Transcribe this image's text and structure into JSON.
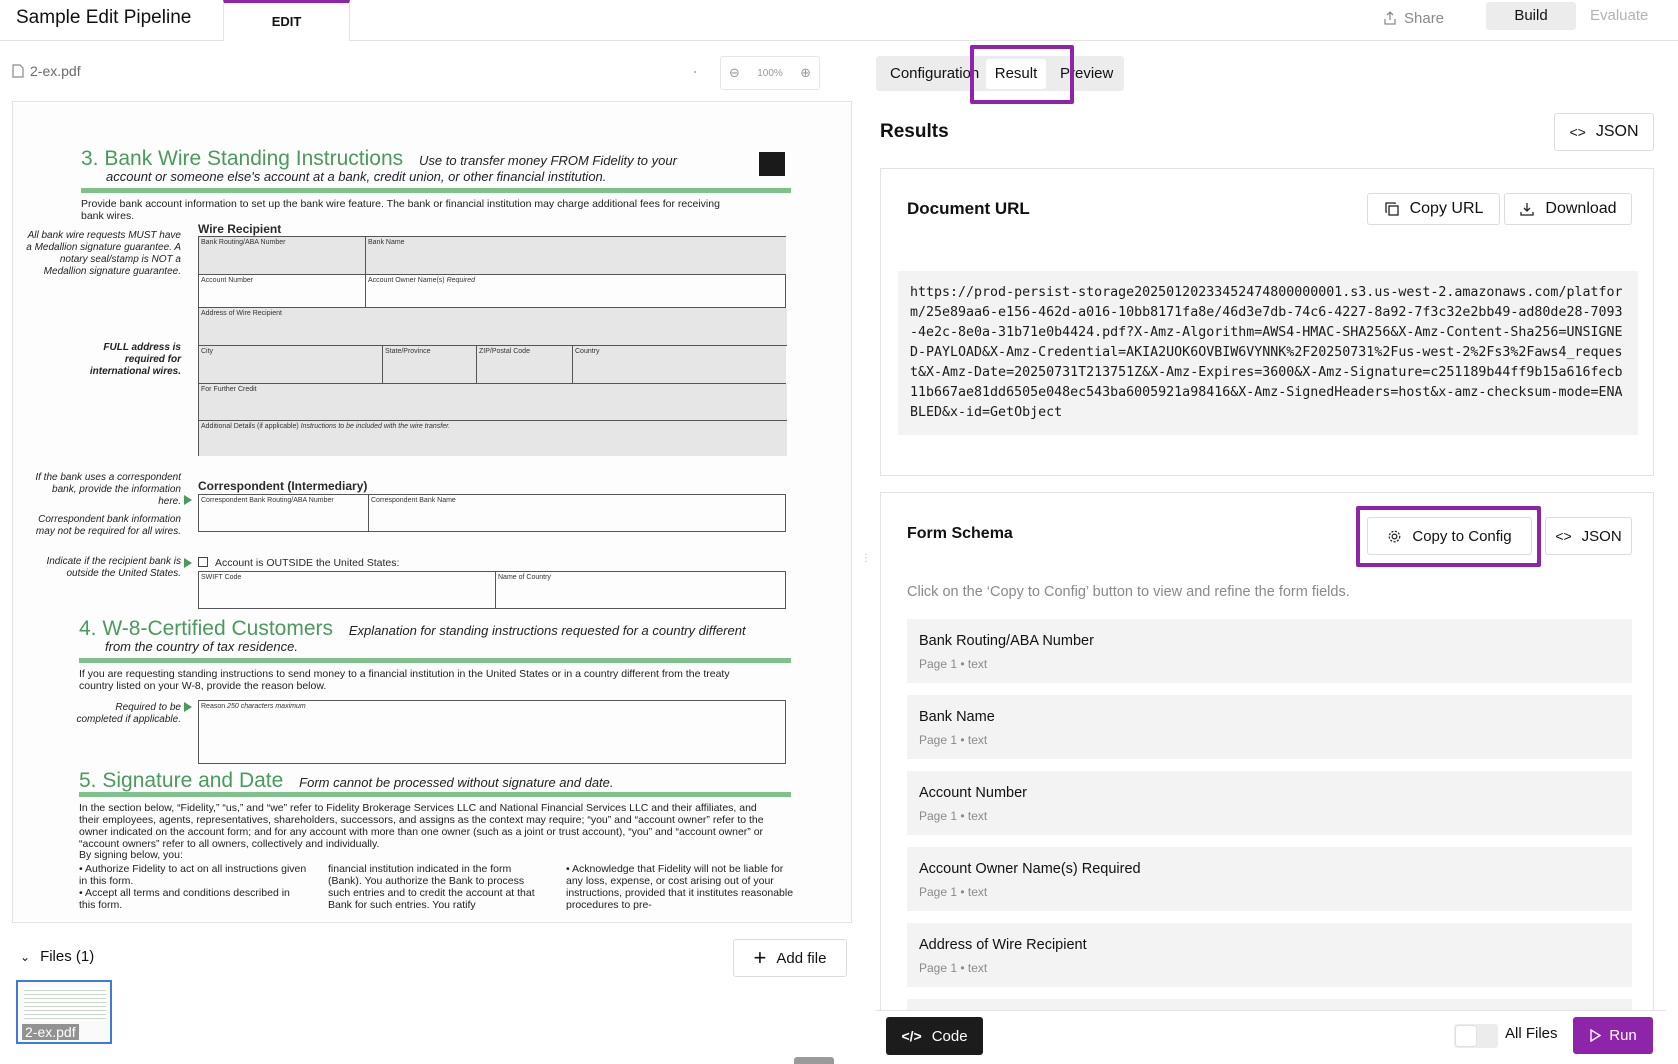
{
  "header": {
    "app_title": "Sample Edit Pipeline",
    "edit_tab": "EDIT",
    "share_label": "Share",
    "build_label": "Build",
    "evaluate_label": "Evaluate"
  },
  "viewer": {
    "file_name": "2-ex.pdf",
    "zoom": "100%"
  },
  "document": {
    "s3_title": "3. Bank Wire Standing Instructions",
    "s3_sub1": "Use to transfer money FROM Fidelity to your",
    "s3_sub2": "account or someone else's account at a bank, credit union, or other financial institution.",
    "s3_intro": "Provide bank account information to set up the bank wire feature. The bank or financial institution may charge additional fees for receiving bank wires.",
    "note_medallion": "All bank wire requests MUST have a Medallion signature guarantee. A notary seal/stamp is NOT a Medallion signature guarantee.",
    "note_address": "FULL address is required for international wires.",
    "wire_recipient": "Wire Recipient",
    "f_routing": "Bank Routing/ABA Number",
    "f_bank_name": "Bank Name",
    "f_account_number": "Account Number",
    "f_owner": "Account Owner Name(s)",
    "f_owner_req": "Required",
    "f_address": "Address of Wire Recipient",
    "f_city": "City",
    "f_state": "State/Province",
    "f_zip": "ZIP/Postal Code",
    "f_country": "Country",
    "f_further": "For Further Credit",
    "f_additional": "Additional Details (if applicable)",
    "f_additional_note": "Instructions to be included with the wire transfer.",
    "note_correspondent": "If the bank uses a correspondent bank, provide the information here.",
    "note_medallion2": "Correspondent bank information may not be required for all wires.",
    "correspondent": "Correspondent (Intermediary)",
    "f_corr_routing": "Correspondent Bank Routing/ABA Number",
    "f_corr_name": "Correspondent Bank Name",
    "note_outside": "Indicate if the recipient bank is outside the United States.",
    "outside_label": "Account is OUTSIDE the United States:",
    "f_swift": "SWIFT Code",
    "f_country_name": "Name of Country",
    "s4_title": "4. W-8-Certified Customers",
    "s4_sub1": "Explanation for standing instructions requested for a country different",
    "s4_sub2": "from the country of tax residence.",
    "s4_intro": "If you are requesting standing instructions to send money to a financial institution in the United States or in a country different from the treaty country listed on your W-8, provide the reason below.",
    "note_required": "Required to be completed if applicable.",
    "f_reason": "Reason",
    "f_reason_note": "250 characters maximum",
    "s5_title": "5. Signature and Date",
    "s5_sub": "Form cannot be processed without signature and date.",
    "s5_body": "In the section below, “Fidelity,” “us,” and “we” refer to Fidelity Brokerage Services LLC and National Financial Services LLC and their affiliates, and their employees, agents, representatives, shareholders, successors, and assigns as the context may require; “you” and “account owner” refer to the owner indicated on the account form; and for any account with more than one owner (such as a joint or trust account), “you” and “account owner” or “account owners” refer to all owners, collectively and individually.",
    "s5_by_signing": "By signing below, you:",
    "s5_col1": "• Authorize Fidelity to act on all instructions given in this form.\n• Accept all terms and conditions described in this form.",
    "s5_col2": "financial institution indicated in the form (Bank). You authorize the Bank to process such entries and to credit the account at that Bank for such entries. You ratify",
    "s5_col3": "• Acknowledge that Fidelity will not be liable for any loss, expense, or cost arising out of your instructions, provided that it institutes reasonable procedures to pre-"
  },
  "files": {
    "label": "Files (1)",
    "add_label": "Add file",
    "thumb_label": "2-ex.pdf"
  },
  "tabs": {
    "configuration": "Configuration",
    "result": "Result",
    "preview": "Preview"
  },
  "results": {
    "title": "Results",
    "json_label": "JSON",
    "doc_url_title": "Document URL",
    "copy_url_label": "Copy URL",
    "download_label": "Download",
    "url": "https://prod-persist-storage20250120233452474800000001.s3.us-west-2.amazonaws.com/platform/25e89aa6-e156-462d-a016-10bb8171fa8e/46d3e7db-74c6-4227-8a92-7f3c32e2bb49-ad80de28-7093-4e2c-8e0a-31b71e0b4424.pdf?X-Amz-Algorithm=AWS4-HMAC-SHA256&X-Amz-Content-Sha256=UNSIGNED-PAYLOAD&X-Amz-Credential=AKIA2UOK6OVBIW6VYNNK%2F20250731%2Fus-west-2%2Fs3%2Faws4_request&X-Amz-Date=20250731T213751Z&X-Amz-Expires=3600&X-Amz-Signature=c251189b44ff9b15a616fecb11b667ae81dd6505e048ec543ba6005921a98416&X-Amz-SignedHeaders=host&x-amz-checksum-mode=ENABLED&x-id=GetObject",
    "schema_title": "Form Schema",
    "copy_config_label": "Copy to Config",
    "schema_json_label": "JSON",
    "schema_hint": "Click on the ‘Copy to Config’ button to view and refine the form fields.",
    "fields": [
      {
        "name": "Bank Routing/ABA Number",
        "meta": "Page 1 • text"
      },
      {
        "name": "Bank Name",
        "meta": "Page 1 • text"
      },
      {
        "name": "Account Number",
        "meta": "Page 1 • text"
      },
      {
        "name": "Account Owner Name(s) Required",
        "meta": "Page 1 • text"
      },
      {
        "name": "Address of Wire Recipient",
        "meta": "Page 1 • text"
      }
    ]
  },
  "footer": {
    "code_label": "Code",
    "all_files_label": "All Files",
    "run_label": "Run"
  },
  "colors": {
    "accent": "#8e24aa",
    "section_green": "#4a9a5e",
    "thumb_border": "#3d7bd9"
  }
}
